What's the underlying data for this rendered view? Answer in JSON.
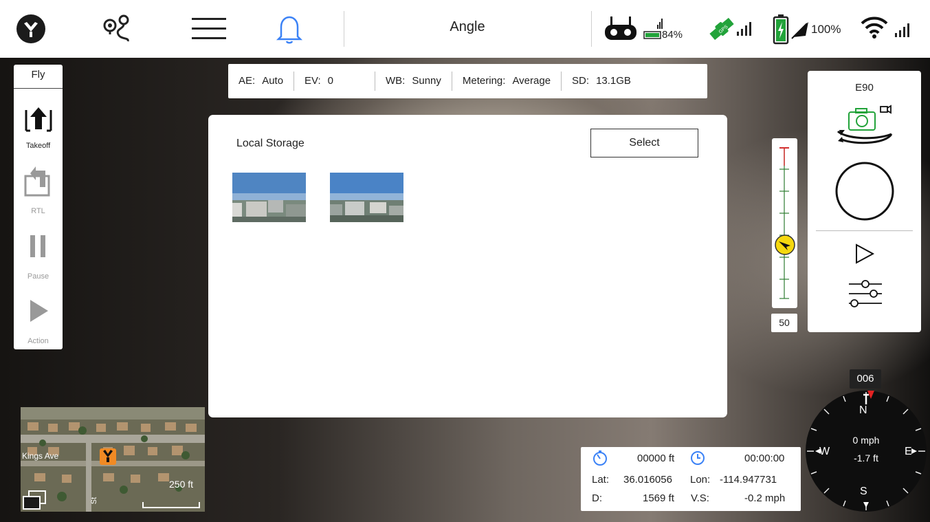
{
  "topbar": {
    "mode_title": "Angle",
    "rc_battery_pct": "84%",
    "aircraft_battery_pct": "100%",
    "gps_label": "GPS"
  },
  "left_panel": {
    "mode": "Fly",
    "takeoff_label": "Takeoff",
    "rtl_label": "RTL",
    "pause_label": "Pause",
    "action_label": "Action"
  },
  "camera_settings": [
    {
      "key": "AE:",
      "value": "Auto"
    },
    {
      "key": "EV:",
      "value": "0"
    },
    {
      "key": "WB:",
      "value": "Sunny"
    },
    {
      "key": "Metering:",
      "value": "Average"
    },
    {
      "key": "SD:",
      "value": "13.1GB"
    }
  ],
  "dialog": {
    "title": "Local Storage",
    "select_label": "Select"
  },
  "altitude_slider": {
    "value": "50"
  },
  "camera_panel": {
    "model": "E90"
  },
  "compass": {
    "heading": "006",
    "north": "N",
    "south": "S",
    "east": "E",
    "west": "W",
    "speed": "0 mph",
    "altitude": "-1.7 ft"
  },
  "telemetry": {
    "distance_value": "00000 ft",
    "flight_time": "00:00:00",
    "lat_label": "Lat:",
    "lat": "36.016056",
    "lon_label": "Lon:",
    "lon": "-114.947731",
    "d_label": "D:",
    "d_value": "1569 ft",
    "vs_label": "V.S:",
    "vs_value": "-0.2 mph"
  },
  "minimap": {
    "street_label": "Kings Ave",
    "scale_label": "250 ft",
    "side_street": "St"
  },
  "colors": {
    "accent_blue": "#3b82f6",
    "gps_green": "#22a33a",
    "slider_green": "#2e7d32",
    "slider_red": "#d32f2f",
    "marker_yellow": "#f5d80f",
    "home_orange": "#f08a24"
  }
}
